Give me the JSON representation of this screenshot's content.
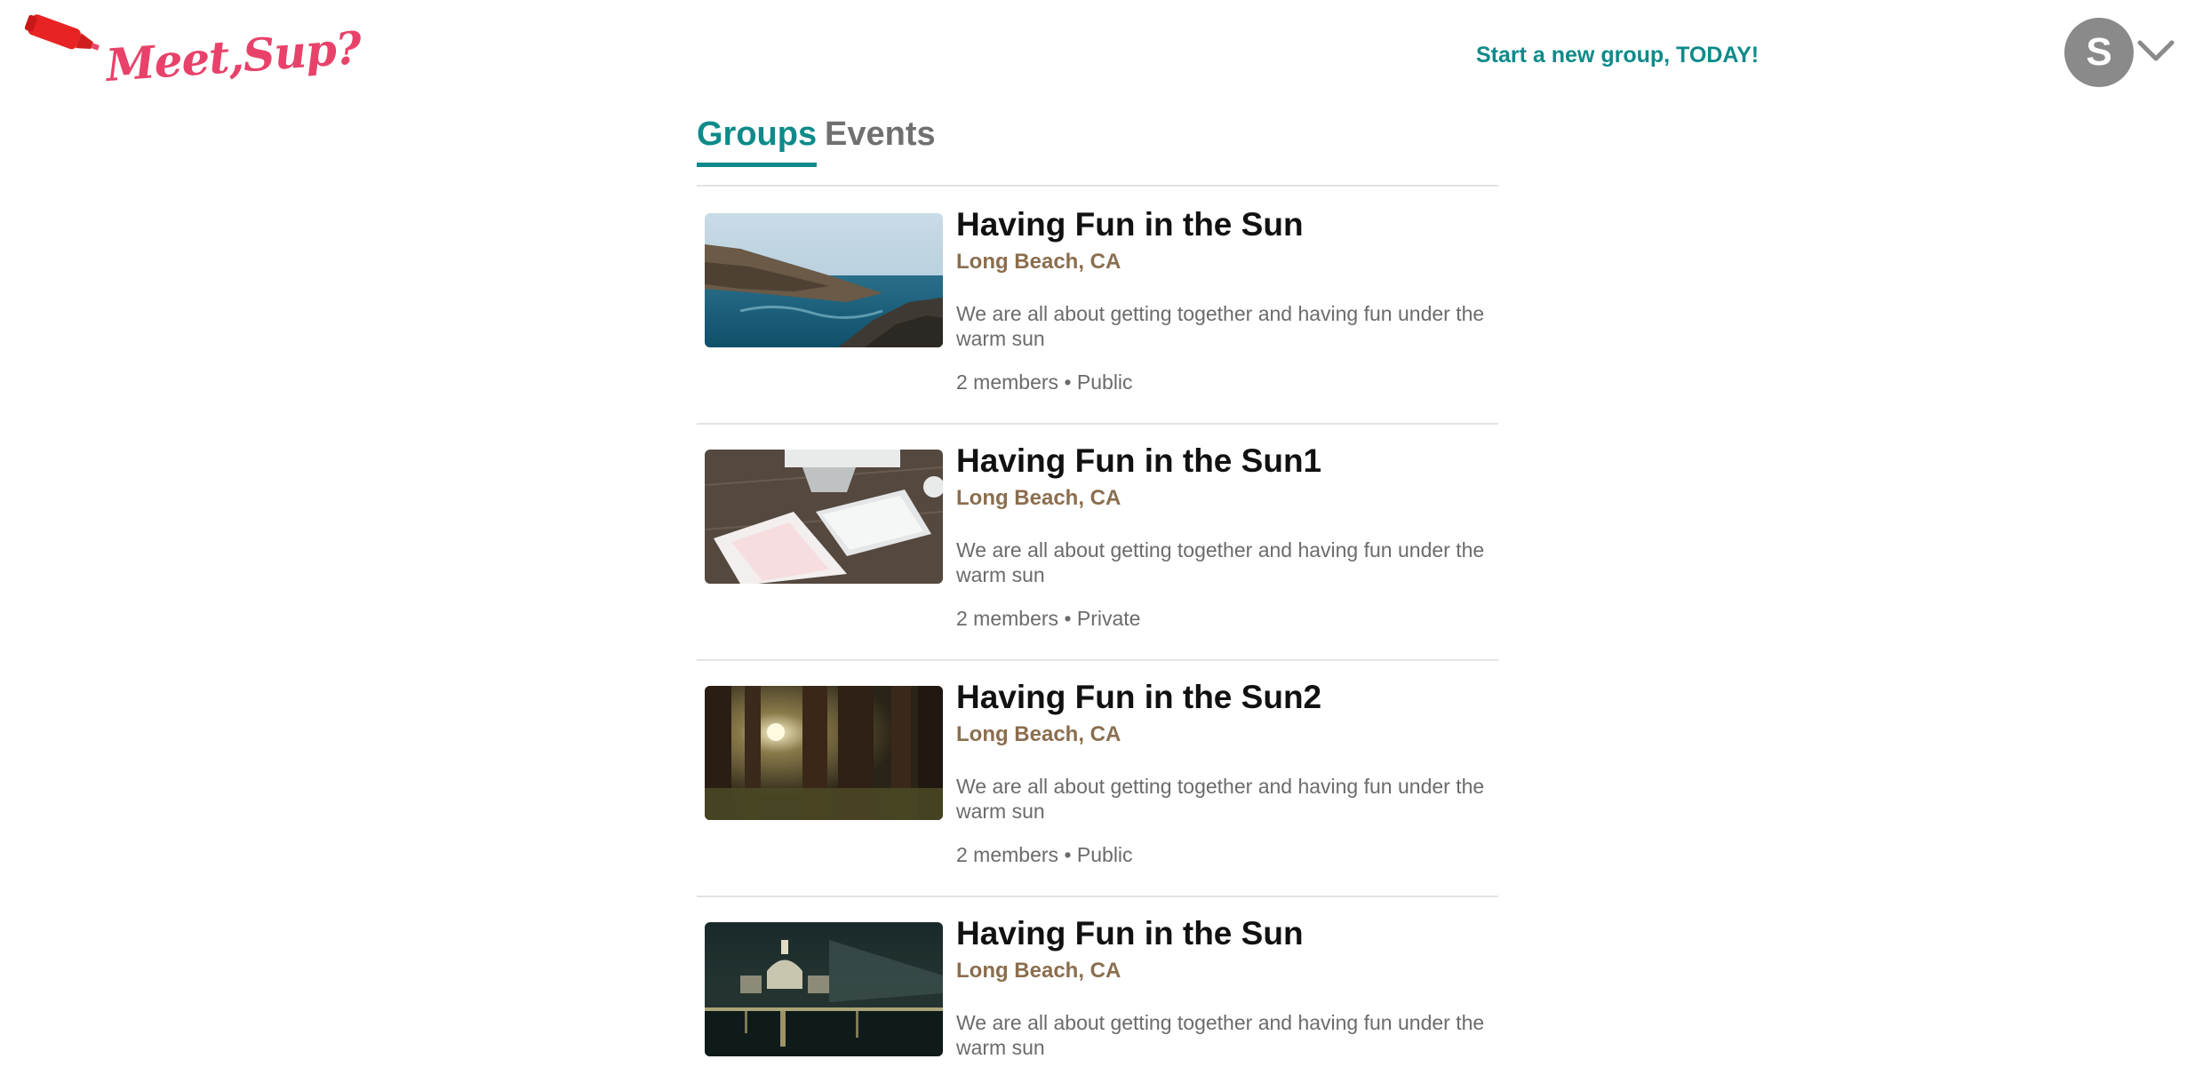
{
  "header": {
    "logo_text": "Meet,Sup?",
    "cta": "Start a new group, TODAY!",
    "avatar_initial": "S"
  },
  "tabs": [
    {
      "label": "Groups",
      "active": true
    },
    {
      "label": "Events",
      "active": false
    }
  ],
  "groups": [
    {
      "title": "Having Fun in the Sun",
      "location": "Long Beach, CA",
      "description": "We are all about getting together and having fun under the warm sun",
      "members": "2 members",
      "separator": "•",
      "privacy": "Public",
      "image": "coastline-photo"
    },
    {
      "title": "Having Fun in the Sun1",
      "location": "Long Beach, CA",
      "description": "We are all about getting together and having fun under the warm sun",
      "members": "2 members",
      "separator": "•",
      "privacy": "Private",
      "image": "desk-keyboard-photo"
    },
    {
      "title": "Having Fun in the Sun2",
      "location": "Long Beach, CA",
      "description": "We are all about getting together and having fun under the warm sun",
      "members": "2 members",
      "separator": "•",
      "privacy": "Public",
      "image": "forest-photo"
    },
    {
      "title": "Having Fun in the Sun",
      "location": "Long Beach, CA",
      "description": "We are all about getting together and having fun under the warm sun",
      "members": "",
      "separator": "",
      "privacy": "",
      "image": "city-night-photo"
    }
  ],
  "colors": {
    "accent": "#0e8a8a",
    "logo": "#e8426a",
    "location": "#8b6e4e",
    "avatar": "#8a8a8a"
  }
}
